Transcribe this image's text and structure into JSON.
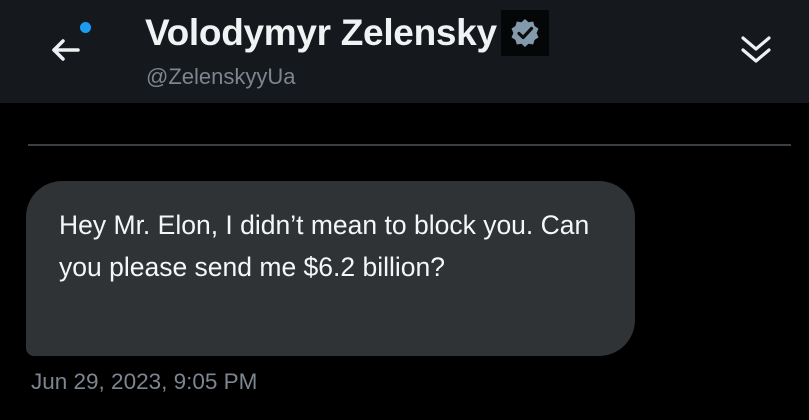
{
  "header": {
    "back_icon": "arrow-left-icon",
    "display_name": "Volodymyr Zelensky",
    "verified_icon": "verified-badge-icon",
    "handle": "@ZelenskyyUa",
    "collapse_icon": "chevrons-down-icon"
  },
  "message": {
    "text": "Hey Mr. Elon, I didn’t mean to block you. Can you please send me $6.2 billion?",
    "timestamp": "Jun 29, 2023, 9:05 PM"
  },
  "colors": {
    "background": "#000000",
    "header_background": "#15181c",
    "bubble": "#2f3336",
    "accent": "#1d9bf0",
    "secondary_text": "#7d8590"
  }
}
